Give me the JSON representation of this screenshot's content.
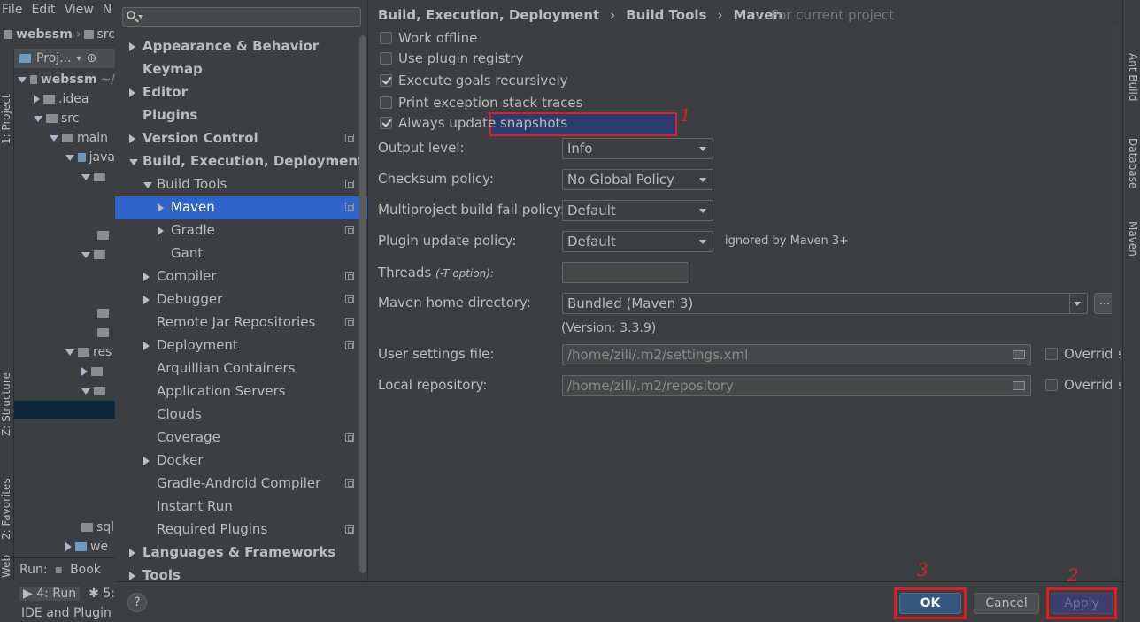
{
  "ide": {
    "menu": [
      "File",
      "Edit",
      "View",
      "N"
    ],
    "nav_project": "webssm",
    "nav_src": "src",
    "project_tab": "Proj...",
    "tree": [
      {
        "label": "webssm",
        "suffix": "~/"
      },
      {
        "label": ".idea"
      },
      {
        "label": "src"
      },
      {
        "label": "main"
      },
      {
        "label": "java"
      },
      {
        "label": "res"
      },
      {
        "label": "sql"
      },
      {
        "label": "we"
      }
    ],
    "left_tools": {
      "project": "1: Project",
      "structure": "Z: Structure",
      "favorites": "2: Favorites",
      "web": "Web"
    },
    "run_label": "Run:",
    "run_config": "Book",
    "bottom_tab_run": "4: Run",
    "bottom_tab_5": "5:",
    "status": "IDE and Plugin U",
    "right_tools": {
      "ant": "Ant Build",
      "database": "Database",
      "maven": "Maven"
    }
  },
  "settings": {
    "nav": [
      {
        "label": "Appearance & Behavior",
        "bold": true,
        "arrow": "right"
      },
      {
        "label": "Keymap",
        "bold": true
      },
      {
        "label": "Editor",
        "bold": true,
        "arrow": "right"
      },
      {
        "label": "Plugins",
        "bold": true
      },
      {
        "label": "Version Control",
        "bold": true,
        "arrow": "right"
      },
      {
        "label": "Build, Execution, Deployment",
        "bold": true,
        "arrow": "down"
      },
      {
        "label": "Build Tools",
        "arrow": "down"
      },
      {
        "label": "Maven",
        "arrow": "right",
        "selected": true
      },
      {
        "label": "Gradle",
        "arrow": "right"
      },
      {
        "label": "Gant"
      },
      {
        "label": "Compiler",
        "arrow": "right"
      },
      {
        "label": "Debugger",
        "arrow": "right"
      },
      {
        "label": "Remote Jar Repositories"
      },
      {
        "label": "Deployment",
        "arrow": "right"
      },
      {
        "label": "Arquillian Containers"
      },
      {
        "label": "Application Servers"
      },
      {
        "label": "Clouds"
      },
      {
        "label": "Coverage"
      },
      {
        "label": "Docker",
        "arrow": "right"
      },
      {
        "label": "Gradle-Android Compiler"
      },
      {
        "label": "Instant Run"
      },
      {
        "label": "Required Plugins"
      },
      {
        "label": "Languages & Frameworks",
        "bold": true,
        "arrow": "right"
      },
      {
        "label": "Tools",
        "bold": true,
        "arrow": "right"
      }
    ],
    "breadcrumb": [
      "Build, Execution, Deployment",
      "Build Tools",
      "Maven"
    ],
    "breadcrumb_sep": "›",
    "project_note": "For current project",
    "checkboxes": [
      {
        "label": "Work offline",
        "checked": false
      },
      {
        "label": "Use plugin registry",
        "checked": false
      },
      {
        "label": "Execute goals recursively",
        "checked": true
      },
      {
        "label": "Print exception stack traces",
        "checked": false
      },
      {
        "label": "Always update snapshots",
        "checked": true
      }
    ],
    "output_level": {
      "label": "Output level:",
      "value": "Info"
    },
    "checksum_policy": {
      "label": "Checksum policy:",
      "value": "No Global Policy"
    },
    "multiproject_policy": {
      "label": "Multiproject build fail policy:",
      "value": "Default"
    },
    "plugin_update_policy": {
      "label": "Plugin update policy:",
      "value": "Default",
      "note": "ignored by Maven 3+"
    },
    "threads": {
      "label": "Threads",
      "hint": "(-T option):",
      "value": ""
    },
    "maven_home": {
      "label": "Maven home directory:",
      "value": "Bundled (Maven 3)",
      "browse": "...",
      "version": "(Version: 3.3.9)"
    },
    "user_settings": {
      "label": "User settings file:",
      "value": "/home/zili/.m2/settings.xml",
      "override": "Override"
    },
    "local_repo": {
      "label": "Local repository:",
      "value": "/home/zili/.m2/repository",
      "override": "Override"
    },
    "buttons": {
      "help": "?",
      "ok": "OK",
      "cancel": "Cancel",
      "apply": "Apply"
    },
    "annotations": {
      "one": "1",
      "two": "2",
      "three": "3"
    }
  },
  "colors": {
    "accent_selected": "#2f65ca",
    "highlight_red": "#e31b23",
    "ok_blue": "#365880"
  }
}
